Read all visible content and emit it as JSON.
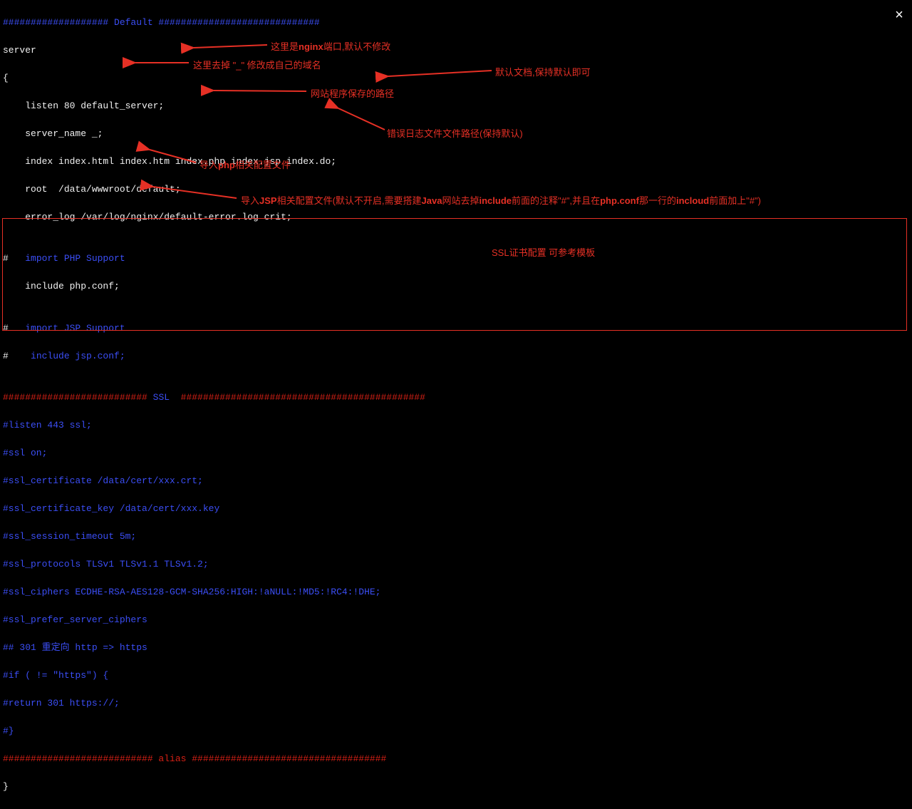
{
  "close": "×",
  "lines": {
    "l0": "################### Default #############################",
    "l1": "server",
    "l2": "{",
    "l3": "    listen 80 default_server;",
    "l4": "    server_name _;",
    "l5": "    index index.html index.htm index.php index.jsp index.do;",
    "l6": "    root  /data/wwwroot/default;",
    "l7": "    error_log /var/log/nginx/default-error.log crit;",
    "l8": "",
    "l9a": "#   ",
    "l9b": "import PHP Support",
    "l10": "    include php.conf;",
    "l11": "",
    "l12a": "#   ",
    "l12b": "import JSP Support",
    "l13a": "#   ",
    "l13b": " include jsp.conf;",
    "l14": "",
    "l15a": "########################## ",
    "l15b": "SSL",
    "l15c": "  ############################################",
    "l16": "#listen 443 ssl;",
    "l17": "#ssl on;",
    "l18": "#ssl_certificate /data/cert/xxx.crt;",
    "l19": "#ssl_certificate_key /data/cert/xxx.key",
    "l20": "#ssl_session_timeout 5m;",
    "l21": "#ssl_protocols TLSv1 TLSv1.1 TLSv1.2;",
    "l22": "#ssl_ciphers ECDHE-RSA-AES128-GCM-SHA256:HIGH:!aNULL:!MD5:!RC4:!DHE;",
    "l23": "#ssl_prefer_server_ciphers",
    "l24": "## 301 重定向 http => https",
    "l25": "#if ( != \"https\") {",
    "l26": "#return 301 https://;",
    "l27": "#}",
    "l28": "########################### alias ###################################",
    "l29": "}"
  },
  "annotations": {
    "a1_pre": "这里是",
    "a1_mid": "nginx",
    "a1_post": "端口,默认不修改",
    "a2": "这里去掉 \"_\" 修改成自己的域名",
    "a3": "默认文档,保持默认即可",
    "a4": "网站程序保存的路径",
    "a5": "错误日志文件文件路径(保持默认)",
    "a6_pre": "导入",
    "a6_mid": "php",
    "a6_post": "相关配置文件",
    "a7_pre": "导入",
    "a7_1": "JSP",
    "a7_2": "相关配置文件(默认不开启,需要搭建",
    "a7_3": "Java",
    "a7_4": "网站去掉",
    "a7_5": "include",
    "a7_6": "前面的注释\"#\",并且在",
    "a7_7": "php.conf",
    "a7_8": "那一行的",
    "a7_9": "incloud",
    "a7_10": "前面加上\"#\")",
    "a8": "SSL证书配置 可参考模板"
  }
}
